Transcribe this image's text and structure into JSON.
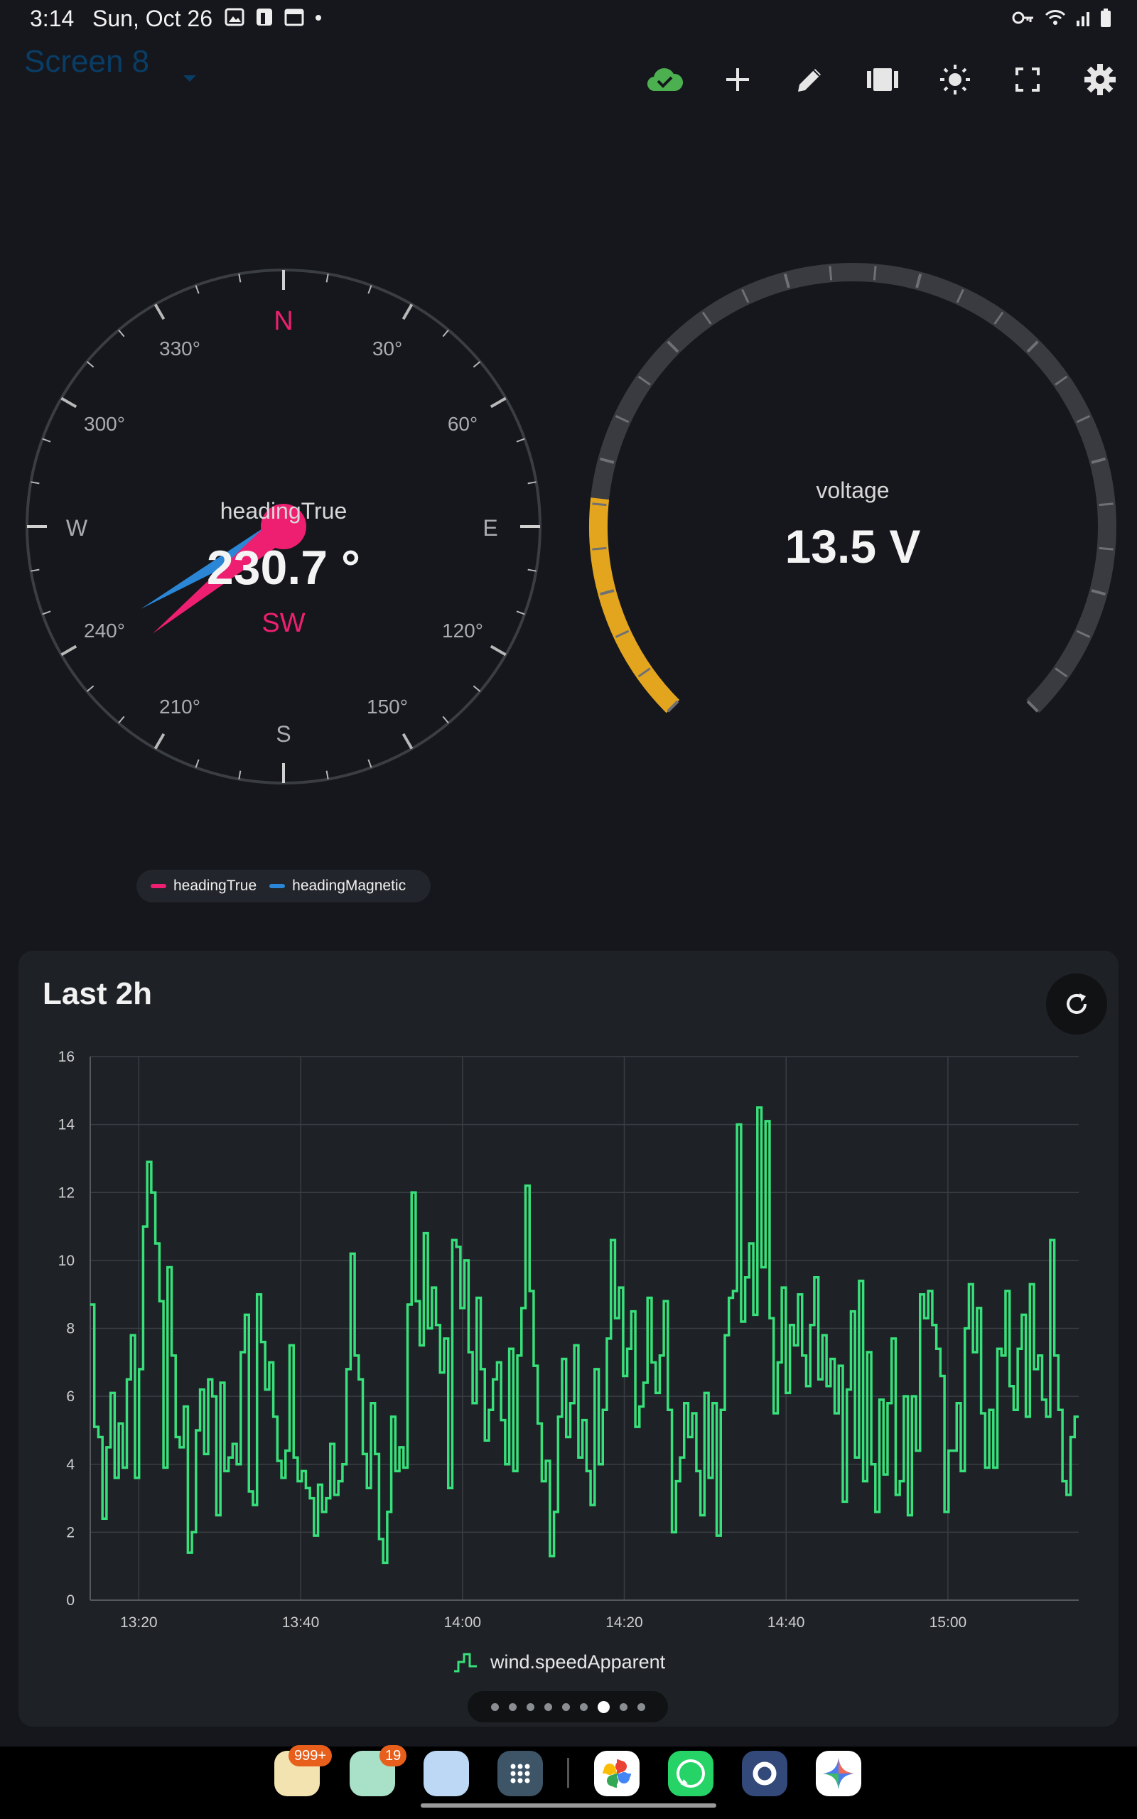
{
  "status_bar": {
    "time": "3:14",
    "date": "Sun, Oct 26"
  },
  "toolbar": {
    "screen_title": "Screen 8",
    "icons": [
      "cloud-check-icon",
      "plus-icon",
      "pencil-icon",
      "carousel-icon",
      "brightness-icon",
      "fullscreen-icon",
      "gear-icon"
    ],
    "sync_color": "#4caf50"
  },
  "compass": {
    "label": "headingTrue",
    "value": "230.7 °",
    "cardinal": "SW",
    "heading_true_deg": 230.7,
    "heading_magnetic_deg": 240,
    "letters": {
      "n": "N",
      "e": "E",
      "s": "S",
      "w": "W"
    },
    "degree_labels": [
      "30°",
      "60°",
      "120°",
      "150°",
      "210°",
      "240°",
      "300°",
      "330°"
    ],
    "colors": {
      "true": "#ee1f70",
      "magnetic": "#2b86d6"
    }
  },
  "gauge": {
    "label": "voltage",
    "value": "13.5 V",
    "level_fraction": 0.19,
    "color": "#e2a51d"
  },
  "compass_legend": [
    {
      "label": "headingTrue",
      "color": "#ee1f70"
    },
    {
      "label": "headingMagnetic",
      "color": "#2b86d6"
    }
  ],
  "card": {
    "title": "Last 2h"
  },
  "chart_data": {
    "type": "line",
    "step": true,
    "title": "Last 2h",
    "ylim": [
      0,
      16
    ],
    "yticks": [
      "0",
      "2",
      "4",
      "6",
      "8",
      "10",
      "12",
      "14",
      "16"
    ],
    "xticks": [
      "13:20",
      "13:40",
      "14:00",
      "14:20",
      "14:40",
      "15:00"
    ],
    "xlim_minutes": [
      13.333,
      135.5
    ],
    "xtick_minutes": [
      19.333,
      39.333,
      59.333,
      79.333,
      99.333,
      119.333
    ],
    "grid": true,
    "legend_position": "bottom",
    "series": [
      {
        "name": "wind.speedApparent",
        "color": "#37e07a",
        "values": [
          8.7,
          5.1,
          4.8,
          2.4,
          4.5,
          6.1,
          3.6,
          5.2,
          3.9,
          6.5,
          7.8,
          3.6,
          6.8,
          11.0,
          12.9,
          12.0,
          10.5,
          8.8,
          3.9,
          9.8,
          7.2,
          4.8,
          4.5,
          5.7,
          1.4,
          2.0,
          5.0,
          6.2,
          4.3,
          6.5,
          6.0,
          2.5,
          6.4,
          3.8,
          4.2,
          4.6,
          4.0,
          7.3,
          8.4,
          3.2,
          2.8,
          9.0,
          7.6,
          6.2,
          7.0,
          5.4,
          4.1,
          3.6,
          4.4,
          7.5,
          4.2,
          3.5,
          3.8,
          3.3,
          3.0,
          1.9,
          3.4,
          2.6,
          3.0,
          4.6,
          3.1,
          3.5,
          4.0,
          6.8,
          10.2,
          7.2,
          6.5,
          4.3,
          3.3,
          5.8,
          4.3,
          1.8,
          1.1,
          2.6,
          5.4,
          3.8,
          4.5,
          3.9,
          8.7,
          12.0,
          8.8,
          7.5,
          10.8,
          8.0,
          9.2,
          8.1,
          6.7,
          7.7,
          3.3,
          10.6,
          10.4,
          8.6,
          10.0,
          7.3,
          5.8,
          8.9,
          6.8,
          4.7,
          5.6,
          6.5,
          7.0,
          5.3,
          4.0,
          7.4,
          3.8,
          7.2,
          8.6,
          12.2,
          9.1,
          6.9,
          5.2,
          3.5,
          4.1,
          1.3,
          2.6,
          5.4,
          7.1,
          4.8,
          5.8,
          7.5,
          4.2,
          5.3,
          3.8,
          2.8,
          6.8,
          4.0,
          5.6,
          7.7,
          10.6,
          8.3,
          9.2,
          6.6,
          7.4,
          8.5,
          5.1,
          5.7,
          6.4,
          8.9,
          7.0,
          6.1,
          7.2,
          8.8,
          5.6,
          2.0,
          3.5,
          4.2,
          5.8,
          4.8,
          5.5,
          3.8,
          2.5,
          6.1,
          3.6,
          5.8,
          1.9,
          5.6,
          7.8,
          8.9,
          9.1,
          14.0,
          8.2,
          9.5,
          10.5,
          8.4,
          14.5,
          9.8,
          14.1,
          8.3,
          5.5,
          7.0,
          9.2,
          6.1,
          8.1,
          7.5,
          9.0,
          7.2,
          6.3,
          8.1,
          9.5,
          6.5,
          7.8,
          6.3,
          7.1,
          5.5,
          6.9,
          2.9,
          6.2,
          8.5,
          4.2,
          9.4,
          3.5,
          7.3,
          4.0,
          2.6,
          5.9,
          3.7,
          5.8,
          7.7,
          3.1,
          3.5,
          6.0,
          2.5,
          6.0,
          4.4,
          9.0,
          8.3,
          9.1,
          8.1,
          7.4,
          6.6,
          2.6,
          4.4,
          4.4,
          5.8,
          3.8,
          8.0,
          9.3,
          7.3,
          8.6,
          5.5,
          3.9,
          5.6,
          3.9,
          7.4,
          7.2,
          9.1,
          6.3,
          5.6,
          7.4,
          8.4,
          5.4,
          9.3,
          6.8,
          7.2,
          5.9,
          5.4,
          10.6,
          7.2,
          5.6,
          3.5,
          3.1,
          4.8,
          5.4
        ]
      }
    ]
  },
  "pager": {
    "count": 9,
    "active": 6
  },
  "dock": {
    "apps": [
      {
        "name": "folder-app-icon",
        "badge": "999+",
        "color": "#f2e3b0"
      },
      {
        "name": "tools-folder-icon",
        "badge": "19",
        "color": "#a8e0c8"
      },
      {
        "name": "search-folder-icon",
        "badge": "",
        "color": "#bcd8f4"
      },
      {
        "name": "app-drawer-icon",
        "badge": "",
        "color": "#3e5568"
      },
      {
        "name": "photos-app-icon",
        "badge": "",
        "color": "#ffffff"
      },
      {
        "name": "whatsapp-app-icon",
        "badge": "",
        "color": "#25d366"
      },
      {
        "name": "settings-app-icon",
        "badge": "",
        "color": "#33497a"
      },
      {
        "name": "gemini-app-icon",
        "badge": "",
        "color": "#ffffff"
      }
    ]
  }
}
